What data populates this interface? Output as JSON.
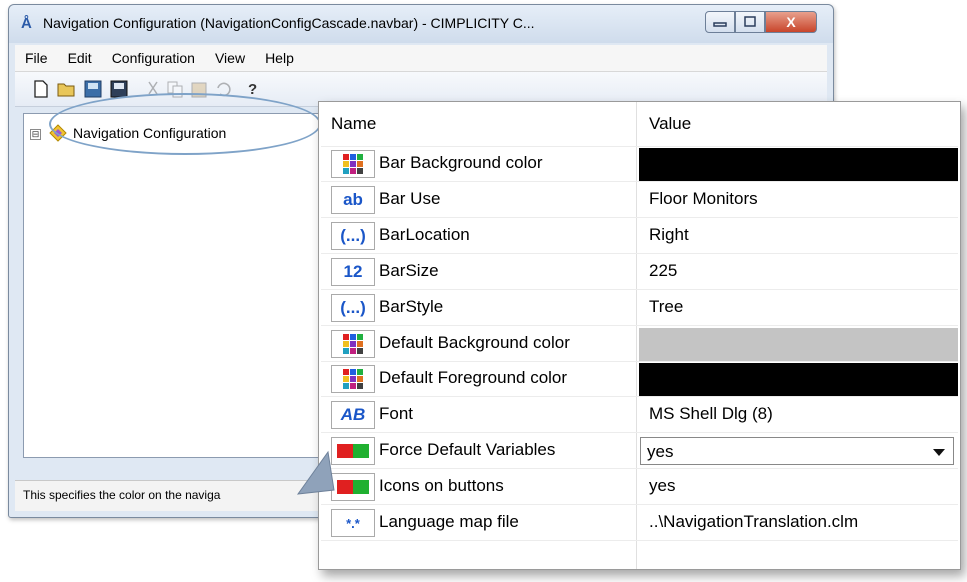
{
  "window": {
    "title": "Navigation Configuration (NavigationConfigCascade.navbar) - CIMPLICITY C...",
    "controls": {
      "minimize": "▭",
      "maximize": "□",
      "close": "X"
    }
  },
  "menubar": [
    "File",
    "Edit",
    "Configuration",
    "View",
    "Help"
  ],
  "toolbar": {
    "icons": [
      "new-icon",
      "open-icon",
      "save-as-icon",
      "save-icon",
      "cut-icon",
      "copy-icon",
      "paste-icon",
      "undo-icon",
      "help-icon"
    ]
  },
  "tree": {
    "root_label": "Navigation Configuration",
    "expander": "⊟"
  },
  "status": {
    "text": "This specifies the color on the naviga"
  },
  "properties": {
    "header_name": "Name",
    "header_value": "Value",
    "rows": [
      {
        "icon": "color-grid-icon",
        "icon_text": "",
        "name": "Bar Background color",
        "value": "",
        "swatch": "#000000"
      },
      {
        "icon": "text-ab-icon",
        "icon_text": "ab",
        "name": "Bar Use",
        "value": "Floor Monitors"
      },
      {
        "icon": "enum-ellipsis-icon",
        "icon_text": "(...)",
        "name": "BarLocation",
        "value": "Right"
      },
      {
        "icon": "number-12-icon",
        "icon_text": "12",
        "name": "BarSize",
        "value": "225"
      },
      {
        "icon": "enum-ellipsis-icon",
        "icon_text": "(...)",
        "name": "BarStyle",
        "value": "Tree"
      },
      {
        "icon": "color-grid-icon",
        "icon_text": "",
        "name": "Default Background color",
        "value": "",
        "swatch": "#c4c4c4"
      },
      {
        "icon": "color-grid-icon",
        "icon_text": "",
        "name": "Default Foreground color",
        "value": "",
        "swatch": "#000000"
      },
      {
        "icon": "font-ab-icon",
        "icon_text": "AB",
        "name": "Font",
        "value": "MS Shell Dlg (8)"
      },
      {
        "icon": "boolean-toggle-icon",
        "icon_text": "",
        "name": "Force Default Variables",
        "value": "yes",
        "dropdown": true
      },
      {
        "icon": "boolean-toggle-icon",
        "icon_text": "",
        "name": "Icons on buttons",
        "value": "yes"
      },
      {
        "icon": "file-wildcard-icon",
        "icon_text": "*.*",
        "name": "Language map file",
        "value": "..\\NavigationTranslation.clm"
      }
    ]
  },
  "colors": {
    "accent": "#1a56c8",
    "titlebar": "#dfe8f3",
    "close": "#c8452b",
    "highlight_ellipse": "#7fa3c8"
  }
}
